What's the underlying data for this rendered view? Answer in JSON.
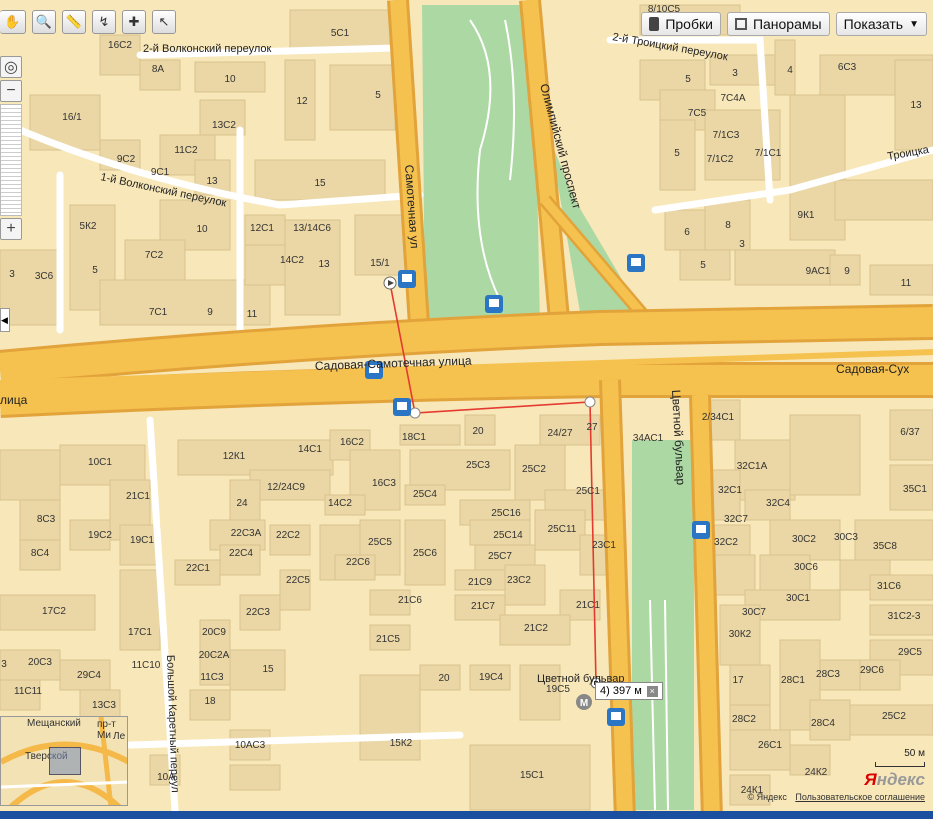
{
  "toolbar": {
    "tools": [
      "hand-tool-icon",
      "magnifier-icon",
      "ruler-icon",
      "route-icon",
      "add-point-icon",
      "select-icon"
    ]
  },
  "top_buttons": {
    "traffic": "Пробки",
    "panoramas": "Панорамы",
    "show": "Показать"
  },
  "streets": {
    "volkonsky2": "2-й Волконский переулок",
    "volkonsky1": "1-й Волконский переулок",
    "samotechnaya": "Самотечная ул",
    "olimpiysky": "Олимпийский проспект",
    "troitsky2": "2-й Троицкий переулок",
    "troitsk": "Троицка",
    "sadovaya_samotechnaya": "Садовая-Самотечная улица",
    "sadovaya_sukh": "Садовая-Сух",
    "ulitsa": "лица",
    "tsvetnoy": "Цветной бульвар",
    "bolshoy_karetny": "Большой Каретный переул",
    "metro": "Цветной бульвар"
  },
  "buildings": [
    "16С2",
    "5С1",
    "8А",
    "10",
    "5",
    "16/1",
    "12",
    "13С2",
    "11С2",
    "9С2",
    "9С1",
    "13",
    "15",
    "5К2",
    "10",
    "12С1",
    "13/14С6",
    "7С2",
    "14С2",
    "13",
    "15/1",
    "3",
    "3С6",
    "5",
    "7С1",
    "9",
    "11",
    "8/10С5",
    "3",
    "5",
    "7С4А",
    "4",
    "6С3",
    "7С5",
    "13",
    "5",
    "7/1С3",
    "7/1С1",
    "7/1С2",
    "9К1",
    "6",
    "8",
    "3",
    "5",
    "9АС1",
    "9",
    "11",
    "18С1",
    "20",
    "24/27",
    "27",
    "34АС1",
    "2/34С1",
    "6/37",
    "12К1",
    "14С1",
    "16С2",
    "25С3",
    "25С2",
    "10С1",
    "12/24С9",
    "16С3",
    "25С4",
    "32С1А",
    "21С1",
    "24",
    "14С2",
    "25С16",
    "25С1",
    "32С1",
    "32С4",
    "35С1",
    "8С3",
    "22С3А",
    "25С14",
    "25С11",
    "32С7",
    "19С2",
    "19С1",
    "22С2",
    "25С5",
    "23С1",
    "32С2",
    "30С2",
    "30С3",
    "35С8",
    "8С4",
    "22С4",
    "22С6",
    "25С6",
    "25С7",
    "30С6",
    "22С1",
    "22С5",
    "21С9",
    "23С2",
    "31С6",
    "21С6",
    "21С7",
    "21С1",
    "30С7",
    "30С1",
    "31С2-3",
    "17С2",
    "22С3",
    "21С2",
    "17С1",
    "20С9",
    "30К2",
    "29С5",
    "20С2А",
    "21С5",
    "3",
    "11С10",
    "15",
    "20С3",
    "29С4",
    "11С3",
    "20",
    "19С4",
    "19С5",
    "17",
    "28С1",
    "28С3",
    "29С6",
    "11С11",
    "13С3",
    "18",
    "28С2",
    "28С4",
    "25С2",
    "10АС3",
    "15К2",
    "26С1",
    "24К2",
    "10А",
    "15С1",
    "24К1"
  ],
  "distance": {
    "label": "4) 397 м",
    "close": "×"
  },
  "minimap": {
    "labels": [
      "Мещанский",
      "Тверской",
      "пр-т Ми",
      "Ле"
    ]
  },
  "scale": {
    "label": "50 м"
  },
  "logo": {
    "y": "Я",
    "rest": "ндекс"
  },
  "footer": {
    "copyright": "© Яндекс",
    "agreement": "Пользовательское соглашение"
  },
  "colors": {
    "road": "#f5b94a",
    "road_edge": "#e7a63a",
    "block": "#ead7a5",
    "park": "#a9d9a0",
    "route": "#e53a2f",
    "bus": "#2a76c4"
  }
}
